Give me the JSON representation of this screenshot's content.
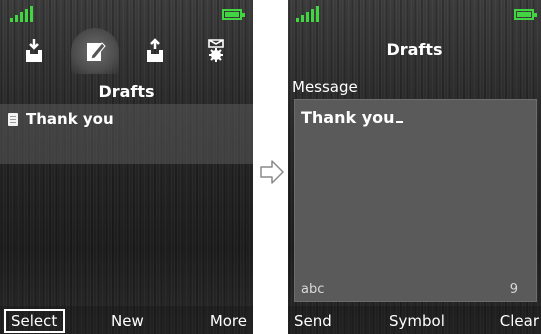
{
  "left_screen": {
    "title": "Drafts",
    "tabs": [
      {
        "icon": "inbox-download-icon",
        "active": false
      },
      {
        "icon": "drafts-edit-icon",
        "active": true
      },
      {
        "icon": "outbox-upload-icon",
        "active": false
      },
      {
        "icon": "message-settings-icon",
        "active": false
      }
    ],
    "list_items": [
      "Thank you"
    ],
    "softkeys": {
      "left": "Select",
      "center": "New",
      "right": "More"
    }
  },
  "right_screen": {
    "title": "Drafts",
    "field_label": "Message",
    "message_text": "Thank you",
    "input_mode": "abc",
    "char_count": "9",
    "softkeys": {
      "left": "Send",
      "center": "Symbol",
      "right": "Clear"
    }
  },
  "colors": {
    "signal": "#41d641",
    "battery": "#41d641"
  }
}
